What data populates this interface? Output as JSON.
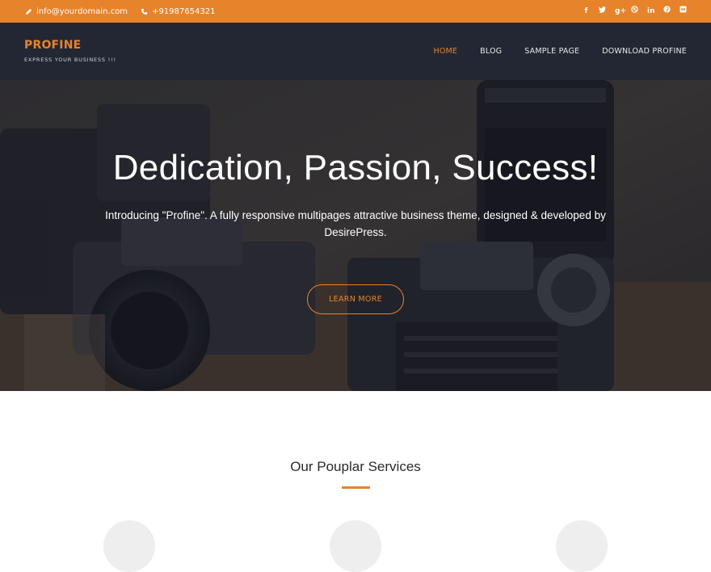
{
  "topbar": {
    "email": "info@yourdomain.com",
    "phone": "+91987654321",
    "social_icons": [
      "facebook-icon",
      "twitter-icon",
      "google-plus-icon",
      "dribbble-icon",
      "linkedin-icon",
      "pinterest-icon",
      "flickr-icon"
    ],
    "background": "#e7832a"
  },
  "header": {
    "site_name": "PROFINE",
    "tagline": "EXPRESS YOUR BUSINESS !!!",
    "background": "#232734",
    "nav": [
      {
        "label": "HOME",
        "active": true
      },
      {
        "label": "BLOG",
        "active": false
      },
      {
        "label": "SAMPLE PAGE",
        "active": false
      },
      {
        "label": "DOWNLOAD PROFINE",
        "active": false
      }
    ]
  },
  "hero": {
    "title": "Dedication, Passion, Success!",
    "text": "Introducing \"Profine\". A fully responsive multipages attractive business theme, designed & developed by DesirePress.",
    "button_label": "LEARN MORE"
  },
  "services": {
    "title": "Our Pouplar Services"
  },
  "colors": {
    "accent": "#e7832a",
    "header_dark": "#232734"
  }
}
